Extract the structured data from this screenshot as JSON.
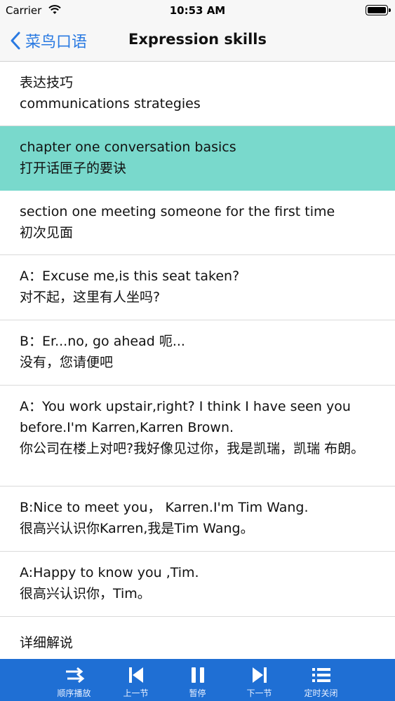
{
  "status_bar": {
    "carrier": "Carrier",
    "time": "10:53 AM"
  },
  "nav": {
    "back_label": "菜鸟口语",
    "title": "Expression skills"
  },
  "rows": [
    {
      "en": "表达技巧",
      "zh": "communications strategies"
    },
    {
      "en": "chapter one conversation basics",
      "zh": "打开话匣子的要诀",
      "active": true
    },
    {
      "en": "section one meeting someone for the first time",
      "zh": "初次见面"
    },
    {
      "en": "A：Excuse me,is this seat taken?",
      "zh": "对不起，这里有人坐吗?"
    },
    {
      "en": "B：Er...no, go ahead 呃...",
      "zh": "没有，您请便吧"
    },
    {
      "en": "A：You work upstair,right? I think I have seen you before.I'm Karren,Karren Brown.",
      "zh": "你公司在楼上对吧?我好像见过你，我是凯瑞，凯瑞 布朗。"
    },
    {
      "en": "B:Nice to meet you，  Karren.I'm Tim Wang.",
      "zh": "很高兴认识你Karren,我是Tim Wang。"
    },
    {
      "en": "A:Happy to know you ,Tim.",
      "zh": "很高兴认识你，Tim。"
    },
    {
      "en": "详细解说",
      "zh": ""
    }
  ],
  "toolbar": {
    "order_label": "顺序播放",
    "prev_label": "上一节",
    "pause_label": "暂停",
    "next_label": "下一节",
    "timer_label": "定时关闭"
  },
  "colors": {
    "accent": "#2a7ae2",
    "highlight": "#79d9cc",
    "toolbar": "#1f6fd4"
  }
}
